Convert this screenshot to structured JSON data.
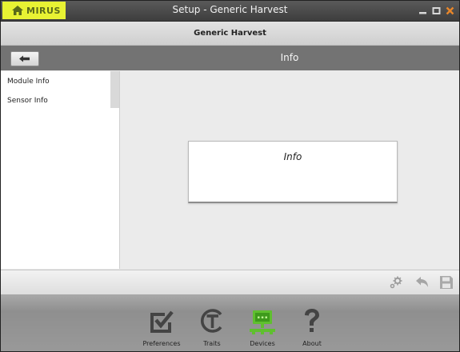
{
  "titlebar": {
    "logo_text": "MIRUS",
    "window_title": "Setup - Generic Harvest"
  },
  "header": {
    "title": "Generic Harvest"
  },
  "navbar": {
    "title": "Info"
  },
  "sidebar": {
    "items": [
      {
        "label": "Module Info"
      },
      {
        "label": "Sensor Info"
      }
    ]
  },
  "main": {
    "card_title": "Info"
  },
  "bottom_nav": {
    "items": [
      {
        "label": "Preferences",
        "icon": "checkbox-icon"
      },
      {
        "label": "Traits",
        "icon": "traits-icon"
      },
      {
        "label": "Devices",
        "icon": "devices-icon",
        "active": true
      },
      {
        "label": "About",
        "icon": "question-icon"
      }
    ]
  },
  "colors": {
    "logo_bg": "#e8f233",
    "close_accent": "#e8862a",
    "devices_active": "#5fbf2f"
  }
}
